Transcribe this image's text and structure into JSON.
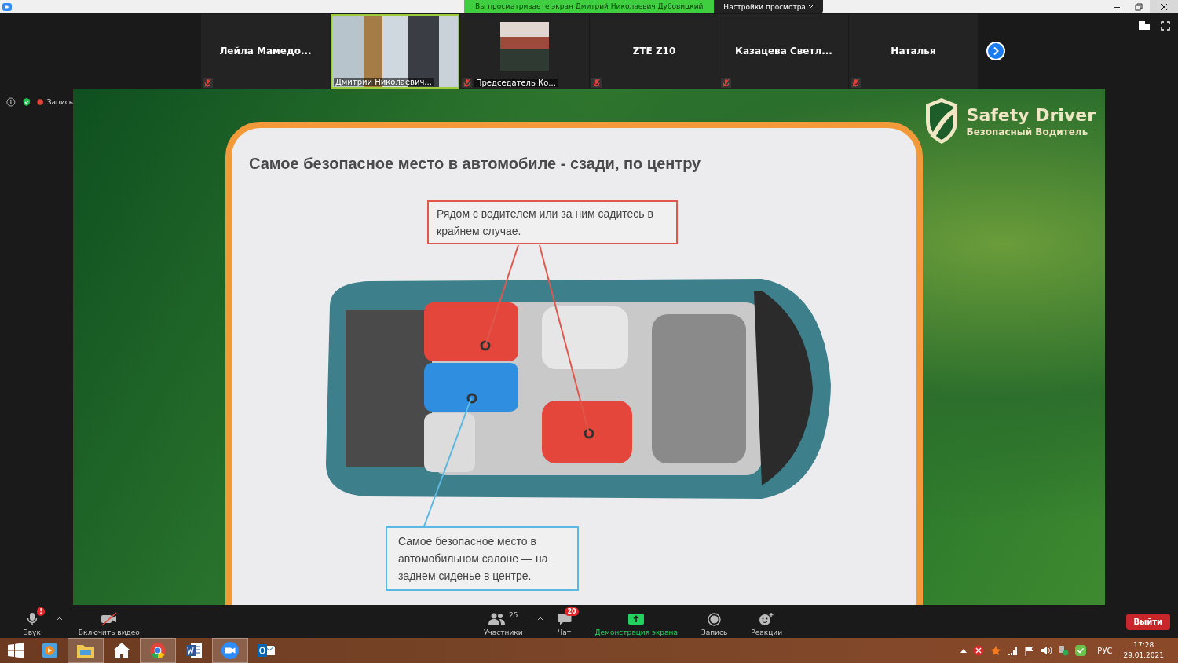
{
  "window": {
    "share_banner": "Вы просматриваете экран Дмитрий Николаевич Дубовицкий",
    "view_options": "Настройки просмотра"
  },
  "participants": [
    {
      "name": "Лейла  Мамедо...",
      "kind": "name",
      "muted": true,
      "active_speaker": false
    },
    {
      "name": "Дмитрий Николаевич...",
      "kind": "camera",
      "muted": false,
      "active_speaker": true
    },
    {
      "name": "Председатель Ко...",
      "kind": "photo",
      "muted": true,
      "active_speaker": false
    },
    {
      "name": "ZTE Z10",
      "kind": "name",
      "muted": true,
      "active_speaker": false
    },
    {
      "name": "Казацева  Светл...",
      "kind": "name",
      "muted": true,
      "active_speaker": false
    },
    {
      "name": "Наталья",
      "kind": "name",
      "muted": true,
      "active_speaker": false
    }
  ],
  "meeting_status": {
    "recording_label": "Запись"
  },
  "slide": {
    "title": "Самое безопасное место в автомобиле - сзади, по центру",
    "callouts": [
      {
        "text": "Рядом с водителем или за ним садитесь в крайнем случае.",
        "color": "#e0584d"
      },
      {
        "text": "Самое безопасное место в автомобильном салоне — на заднем сиденье в центре.",
        "color": "#5ab8e2"
      }
    ],
    "logo": {
      "title": "Safety Driver",
      "subtitle": "Безопасный Водитель"
    }
  },
  "toolbar": [
    {
      "kind": "mic",
      "label": "Звук",
      "badge": "!",
      "caret": true,
      "active": false
    },
    {
      "kind": "video_off",
      "label": "Включить видео",
      "caret": false,
      "active": false
    },
    {
      "kind": "participants",
      "label": "Участники",
      "caret": true,
      "count": "25",
      "active": false
    },
    {
      "kind": "chat",
      "label": "Чат",
      "badge": "20",
      "caret": false,
      "active": false
    },
    {
      "kind": "share",
      "label": "Демонстрация экрана",
      "caret": false,
      "active": true
    },
    {
      "kind": "record",
      "label": "Запись",
      "caret": false,
      "active": false
    },
    {
      "kind": "reactions",
      "label": "Реакции",
      "caret": false,
      "active": false
    }
  ],
  "leave_button": "Выйти",
  "taskbar": {
    "apps": [
      {
        "kind": "media",
        "selected": false
      },
      {
        "kind": "explorer",
        "selected": true
      },
      {
        "kind": "home",
        "selected": false
      },
      {
        "kind": "chrome",
        "selected": true
      },
      {
        "kind": "word",
        "selected": false
      },
      {
        "kind": "zoom",
        "selected": true
      },
      {
        "kind": "outlook",
        "selected": false
      }
    ],
    "language": "РУС",
    "time": "17:28",
    "date": "29.01.2021"
  }
}
